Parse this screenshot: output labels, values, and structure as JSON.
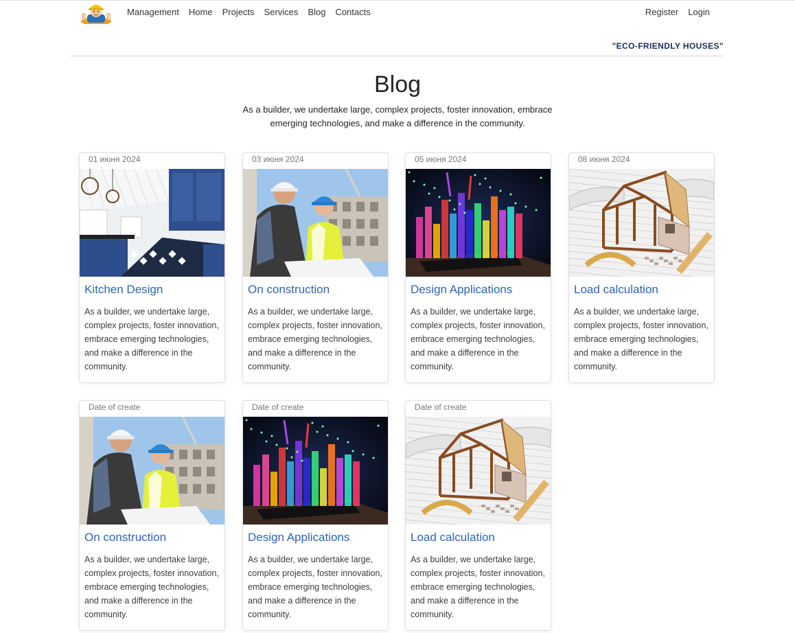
{
  "nav": {
    "logo_icon": "builder-mascot-logo",
    "links": [
      "Management",
      "Home",
      "Projects",
      "Services",
      "Blog",
      "Contacts"
    ],
    "auth": [
      "Register",
      "Login"
    ]
  },
  "tagline": "\"ECO-FRIENDLY HOUSES\"",
  "hero": {
    "title": "Blog",
    "subtitle": "As a builder, we undertake large, complex projects, foster innovation, embrace emerging technologies, and make a difference in the community."
  },
  "cards": [
    {
      "date": "01 июня 2024",
      "title": "Kitchen Design",
      "image": "kitchen",
      "text": "As a builder, we undertake large, complex projects, foster innovation, embrace emerging technologies, and make a difference in the community."
    },
    {
      "date": "03 июня 2024",
      "title": "On construction",
      "image": "workers",
      "text": "As a builder, we undertake large, complex projects, foster innovation, embrace emerging technologies, and make a difference in the community."
    },
    {
      "date": "05 июня 2024",
      "title": "Design Applications",
      "image": "bars",
      "text": "As a builder, we undertake large, complex projects, foster innovation, embrace emerging technologies, and make a difference in the community."
    },
    {
      "date": "08 июня 2024",
      "title": "Load calculation",
      "image": "house-frame",
      "text": "As a builder, we undertake large, complex projects, foster innovation, embrace emerging technologies, and make a difference in the community."
    },
    {
      "date": "Date of create",
      "title": "On construction",
      "image": "workers",
      "text": "As a builder, we undertake large, complex projects, foster innovation, embrace emerging technologies, and make a difference in the community."
    },
    {
      "date": "Date of create",
      "title": "Design Applications",
      "image": "bars",
      "text": "As a builder, we undertake large, complex projects, foster innovation, embrace emerging technologies, and make a difference in the community."
    },
    {
      "date": "Date of create",
      "title": "Load calculation",
      "image": "house-frame",
      "text": "As a builder, we undertake large, complex projects, foster innovation, embrace emerging technologies, and make a difference in the community."
    }
  ],
  "colors": {
    "link_blue": "#2c64b3",
    "tagline_navy": "#1b2d5a",
    "border": "#dcdfe3"
  }
}
